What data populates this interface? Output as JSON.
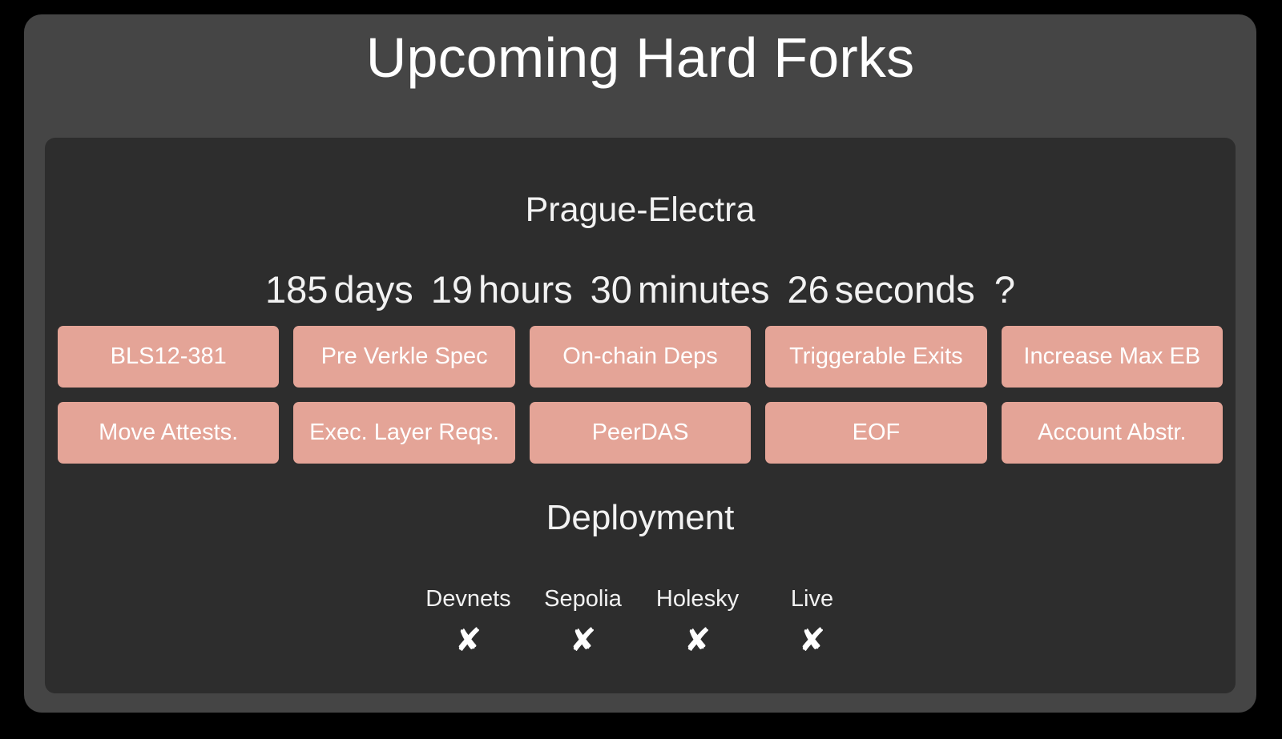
{
  "header": {
    "title": "Upcoming Hard Forks"
  },
  "fork": {
    "name": "Prague-Electra",
    "countdown": {
      "days_value": "185",
      "days_label": "days",
      "hours_value": "19",
      "hours_label": "hours",
      "minutes_value": "30",
      "minutes_label": "minutes",
      "seconds_value": "26",
      "seconds_label": "seconds",
      "suffix": "?"
    },
    "eip_rows": [
      [
        {
          "label": "BLS12-381"
        },
        {
          "label": "Pre Verkle Spec"
        },
        {
          "label": "On-chain Deps"
        },
        {
          "label": "Triggerable Exits"
        },
        {
          "label": "Increase Max EB"
        }
      ],
      [
        {
          "label": "Move Attests."
        },
        {
          "label": "Exec. Layer Reqs."
        },
        {
          "label": "PeerDAS"
        },
        {
          "label": "EOF"
        },
        {
          "label": "Account Abstr."
        }
      ]
    ],
    "deployment": {
      "title": "Deployment",
      "stages": [
        {
          "label": "Devnets",
          "status": "✘"
        },
        {
          "label": "Sepolia",
          "status": "✘"
        },
        {
          "label": "Holesky",
          "status": "✘"
        },
        {
          "label": "Live",
          "status": "✘"
        }
      ]
    }
  },
  "colors": {
    "page_background": "#000000",
    "outer_card": "#454545",
    "inner_card": "#2d2d2d",
    "pill": "#e4a497",
    "text": "#f2f2f2"
  }
}
